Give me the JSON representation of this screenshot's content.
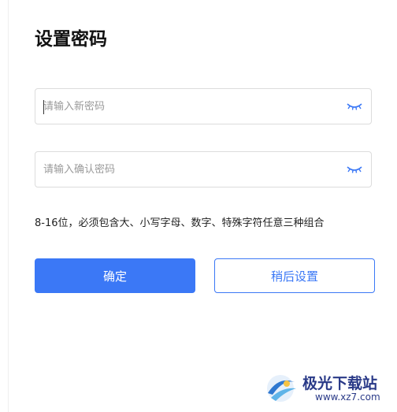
{
  "page": {
    "title": "设置密码",
    "new_password": {
      "value": "",
      "placeholder": "请输入新密码"
    },
    "confirm_password": {
      "value": "",
      "placeholder": "请输入确认密码"
    },
    "hint": "8-16位，必须包含大、小写字母、数字、特殊字符任意三种组合",
    "confirm_button": "确定",
    "later_button": "稍后设置",
    "icons": {
      "toggle_visibility": "eye-closed-icon"
    },
    "colors": {
      "accent": "#3b78f6"
    }
  },
  "watermark": {
    "name": "极光下载站",
    "url": "www.xz7.com"
  }
}
